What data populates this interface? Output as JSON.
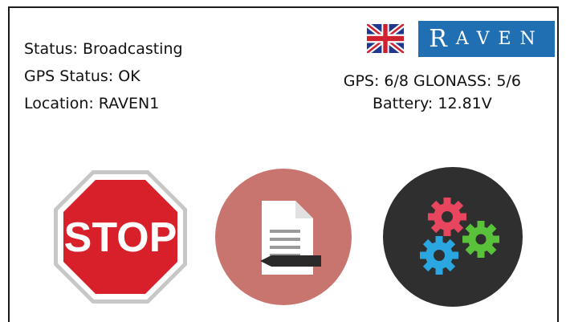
{
  "status": {
    "status_text": "Status: Broadcasting",
    "gps_status_text": "GPS Status: OK",
    "location_text": "Location: RAVEN1"
  },
  "info": {
    "satellites_text": "GPS: 6/8 GLONASS: 5/6",
    "battery_text": "Battery: 12.81V"
  },
  "branding": {
    "logo_text_first": "R",
    "logo_text_rest": "AVEN",
    "logo_color": "#1f6fb2",
    "language_flag_icon": "uk-flag-icon"
  },
  "actions": {
    "stop": {
      "label": "STOP",
      "icon": "stop-sign-icon",
      "color": "#d8202a"
    },
    "log": {
      "icon": "document-edit-icon",
      "color": "#c9756f"
    },
    "settings": {
      "icon": "gears-icon",
      "color": "#2f2f2f"
    }
  }
}
